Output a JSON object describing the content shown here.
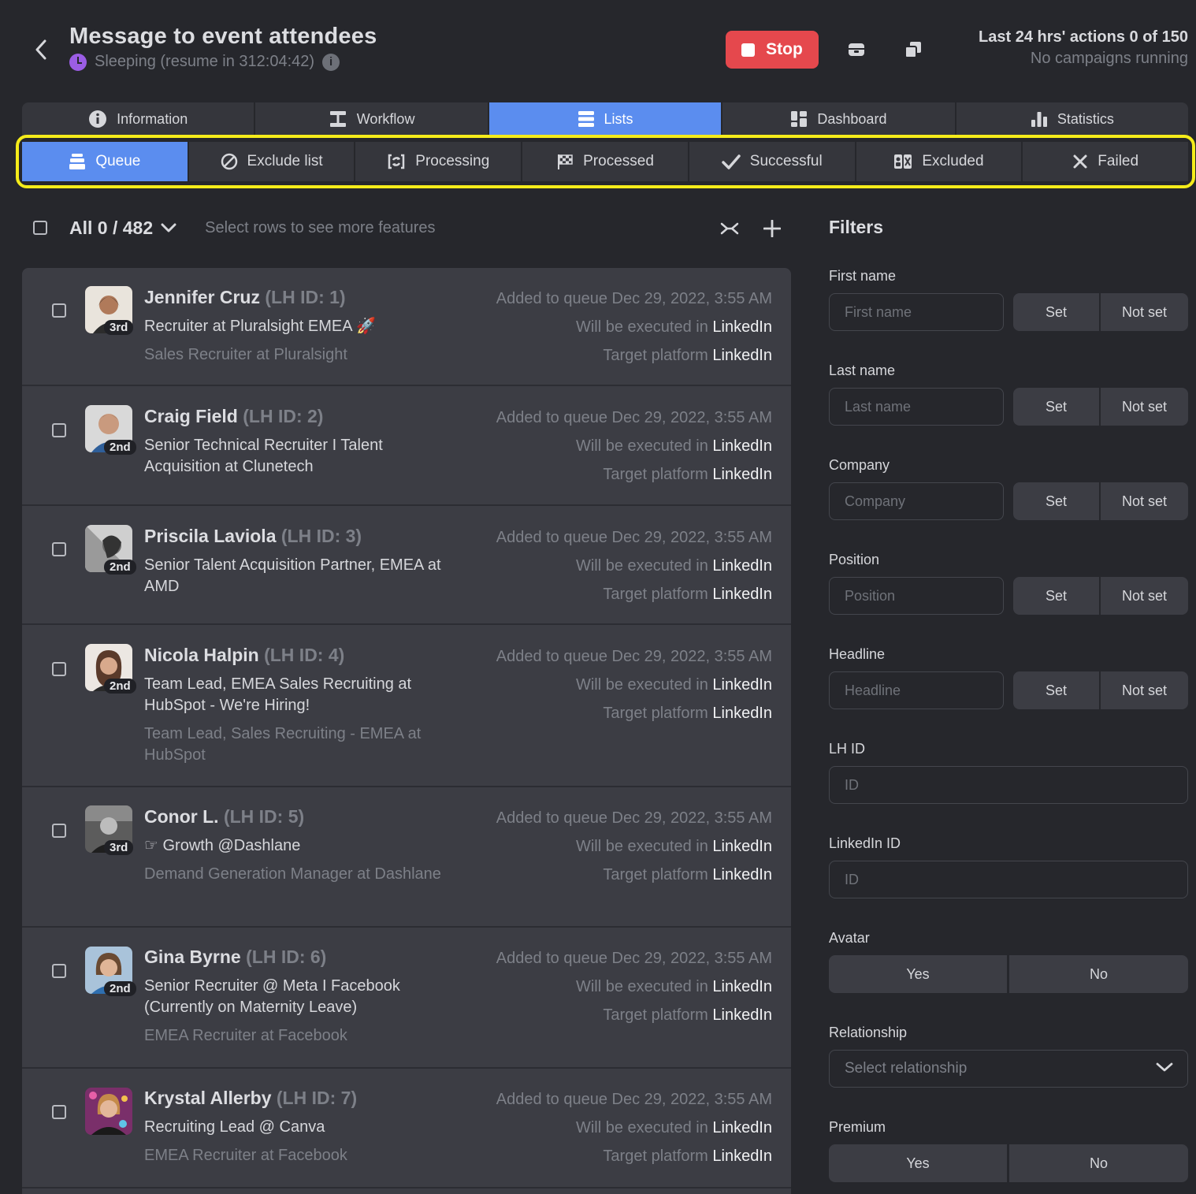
{
  "header": {
    "title": "Message to event attendees",
    "status": "Sleeping (resume in 312:04:42)",
    "stop_label": "Stop",
    "actions_line": "Last 24 hrs' actions 0 of 150",
    "campaigns_line": "No campaigns running"
  },
  "main_tabs": [
    {
      "label": "Information",
      "icon": "info-icon"
    },
    {
      "label": "Workflow",
      "icon": "workflow-icon"
    },
    {
      "label": "Lists",
      "icon": "list-icon",
      "active": true
    },
    {
      "label": "Dashboard",
      "icon": "dashboard-icon"
    },
    {
      "label": "Statistics",
      "icon": "bar-chart-icon"
    }
  ],
  "sub_tabs": [
    {
      "label": "Queue",
      "icon": "queue-icon",
      "active": true
    },
    {
      "label": "Exclude list",
      "icon": "ban-icon"
    },
    {
      "label": "Processing",
      "icon": "sync-icon"
    },
    {
      "label": "Processed",
      "icon": "checkered-flag-icon"
    },
    {
      "label": "Successful",
      "icon": "check-icon"
    },
    {
      "label": "Excluded",
      "icon": "excluded-users-icon"
    },
    {
      "label": "Failed",
      "icon": "x-icon"
    }
  ],
  "toolbar": {
    "count_label": "All 0 / 482",
    "hint": "Select rows to see more features"
  },
  "rows": [
    {
      "name": "Jennifer Cruz",
      "lhid": "(LH ID: 1)",
      "degree": "3rd",
      "headline": "Recruiter at Pluralsight EMEA 🚀",
      "position": "Sales Recruiter at Pluralsight",
      "added": "Added to queue Dec 29, 2022, 3:55 AM",
      "exec_prefix": "Will be executed in ",
      "exec_platform": "LinkedIn",
      "target_prefix": "Target platform ",
      "target_platform": "LinkedIn",
      "avatar_color": "#7a5a48"
    },
    {
      "name": "Craig Field",
      "lhid": "(LH ID: 2)",
      "degree": "2nd",
      "headline": "Senior Technical Recruiter I Talent Acquisition at Clunetech",
      "position": "",
      "added": "Added to queue Dec 29, 2022, 3:55 AM",
      "exec_prefix": "Will be executed in ",
      "exec_platform": "LinkedIn",
      "target_prefix": "Target platform ",
      "target_platform": "LinkedIn",
      "avatar_color": "#3f6fa8"
    },
    {
      "name": "Priscila Laviola",
      "lhid": "(LH ID: 3)",
      "degree": "2nd",
      "headline": "Senior Talent Acquisition Partner, EMEA at AMD",
      "position": "",
      "added": "Added to queue Dec 29, 2022, 3:55 AM",
      "exec_prefix": "Will be executed in ",
      "exec_platform": "LinkedIn",
      "target_prefix": "Target platform ",
      "target_platform": "LinkedIn",
      "avatar_color": "#8e8e8e"
    },
    {
      "name": "Nicola Halpin",
      "lhid": "(LH ID: 4)",
      "degree": "2nd",
      "headline": "Team Lead, EMEA Sales Recruiting at HubSpot - We're Hiring!",
      "position": "Team Lead, Sales Recruiting - EMEA at HubSpot",
      "added": "Added to queue Dec 29, 2022, 3:55 AM",
      "exec_prefix": "Will be executed in ",
      "exec_platform": "LinkedIn",
      "target_prefix": "Target platform ",
      "target_platform": "LinkedIn",
      "avatar_color": "#a06a55"
    },
    {
      "name": "Conor L.",
      "lhid": "(LH ID: 5)",
      "degree": "3rd",
      "headline": "☞ Growth @Dashlane",
      "position": "Demand Generation Manager at Dashlane",
      "added": "Added to queue Dec 29, 2022, 3:55 AM",
      "exec_prefix": "Will be executed in ",
      "exec_platform": "LinkedIn",
      "target_prefix": "Target platform ",
      "target_platform": "LinkedIn",
      "avatar_color": "#5a5a5a"
    },
    {
      "name": "Gina Byrne",
      "lhid": "(LH ID: 6)",
      "degree": "2nd",
      "headline": "Senior Recruiter @ Meta I Facebook (Currently on Maternity Leave)",
      "position": "EMEA Recruiter at Facebook",
      "added": "Added to queue Dec 29, 2022, 3:55 AM",
      "exec_prefix": "Will be executed in ",
      "exec_platform": "LinkedIn",
      "target_prefix": "Target platform ",
      "target_platform": "LinkedIn",
      "avatar_color": "#6e8fb0"
    },
    {
      "name": "Krystal Allerby",
      "lhid": "(LH ID: 7)",
      "degree": "",
      "headline": "Recruiting Lead @ Canva",
      "position": "EMEA Recruiter at Facebook",
      "added": "Added to queue Dec 29, 2022, 3:55 AM",
      "exec_prefix": "Will be executed in ",
      "exec_platform": "LinkedIn",
      "target_prefix": "Target platform ",
      "target_platform": "LinkedIn",
      "avatar_color": "#b04a7a"
    }
  ],
  "filters": {
    "title": "Filters",
    "set_label": "Set",
    "not_set_label": "Not set",
    "yes_label": "Yes",
    "no_label": "No",
    "first_name": {
      "label": "First name",
      "placeholder": "First name"
    },
    "last_name": {
      "label": "Last name",
      "placeholder": "Last name"
    },
    "company": {
      "label": "Company",
      "placeholder": "Company"
    },
    "position": {
      "label": "Position",
      "placeholder": "Position"
    },
    "headline": {
      "label": "Headline",
      "placeholder": "Headline"
    },
    "lh_id": {
      "label": "LH ID",
      "placeholder": "ID"
    },
    "linkedin_id": {
      "label": "LinkedIn ID",
      "placeholder": "ID"
    },
    "avatar": {
      "label": "Avatar"
    },
    "relationship": {
      "label": "Relationship",
      "placeholder": "Select relationship"
    },
    "premium": {
      "label": "Premium"
    }
  },
  "colors": {
    "accent": "#5b8def",
    "stop": "#e5484d",
    "highlight_outline": "#f5ec1a",
    "background": "#26272c",
    "card": "#3c3d44"
  }
}
